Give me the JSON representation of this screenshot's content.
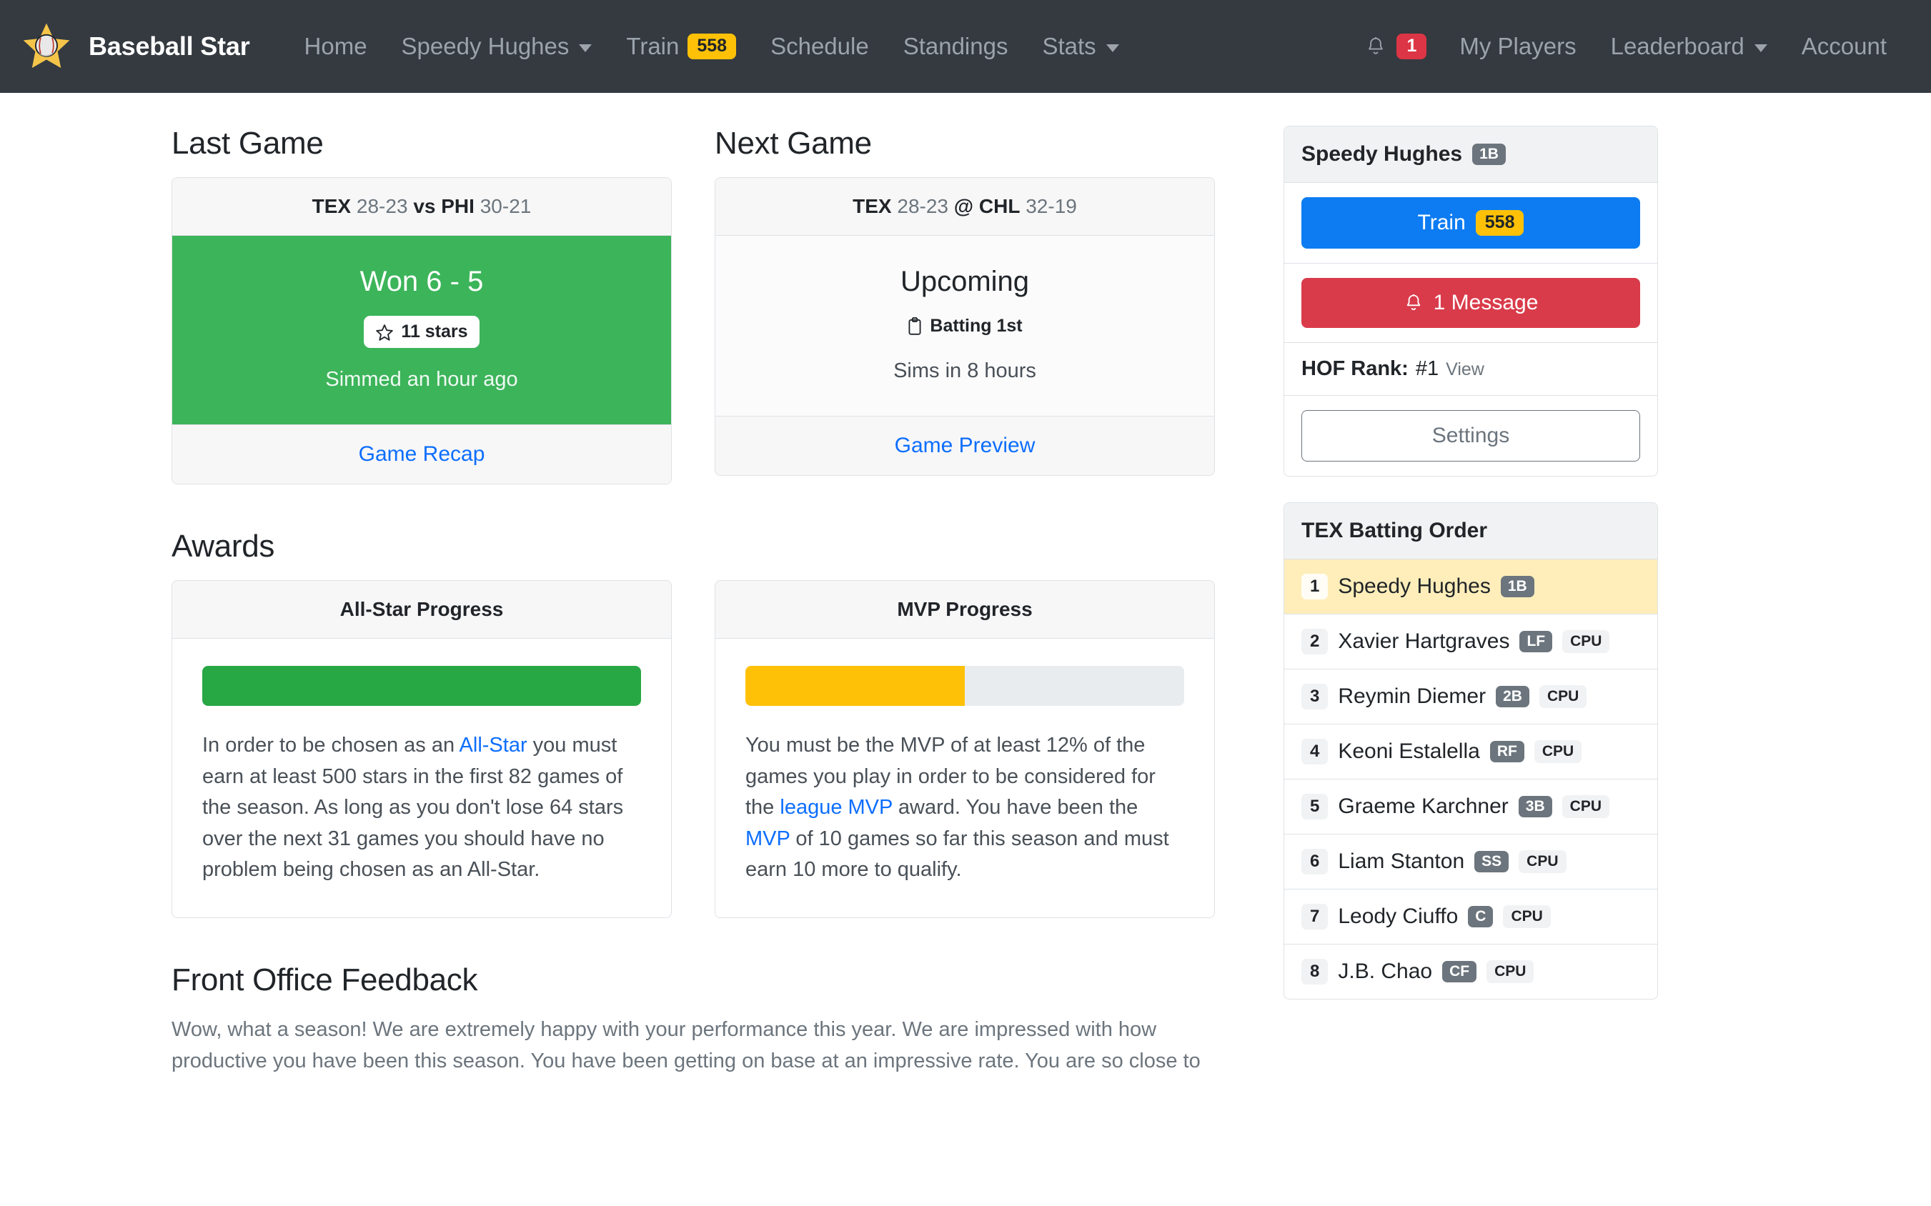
{
  "navbar": {
    "logo_icon": "baseball-star-logo",
    "brand": "Baseball Star",
    "links": [
      {
        "label": "Home",
        "caret": false,
        "badge": null
      },
      {
        "label": "Speedy Hughes",
        "caret": true,
        "badge": null
      },
      {
        "label": "Train",
        "caret": false,
        "badge": "558"
      },
      {
        "label": "Schedule",
        "caret": false,
        "badge": null
      },
      {
        "label": "Standings",
        "caret": false,
        "badge": null
      },
      {
        "label": "Stats",
        "caret": true,
        "badge": null
      }
    ],
    "notification_icon": "bell-icon",
    "notification_count": "1",
    "right_links": [
      {
        "label": "My Players",
        "caret": false
      },
      {
        "label": "Leaderboard",
        "caret": true
      },
      {
        "label": "Account",
        "caret": false
      }
    ]
  },
  "last_game": {
    "heading": "Last Game",
    "home_team": "TEX",
    "home_record": "28-23",
    "separator": "vs",
    "away_team": "PHI",
    "away_record": "30-21",
    "result": "Won 6 - 5",
    "stars_icon": "star-outline-icon",
    "stars": "11 stars",
    "simmed": "Simmed an hour ago",
    "link": "Game Recap"
  },
  "next_game": {
    "heading": "Next Game",
    "home_team": "TEX",
    "home_record": "28-23",
    "separator": "@",
    "away_team": "CHL",
    "away_record": "32-19",
    "status": "Upcoming",
    "batting_icon": "clipboard-icon",
    "batting": "Batting 1st",
    "sims_in": "Sims in 8 hours",
    "link": "Game Preview"
  },
  "awards": {
    "heading": "Awards",
    "all_star": {
      "title": "All-Star Progress",
      "progress_percent": 100,
      "progress_color": "#28a745",
      "text_parts": [
        {
          "t": "In order to be chosen as an ",
          "link": false
        },
        {
          "t": "All-Star",
          "link": true
        },
        {
          "t": " you must earn at least 500 stars in the first 82 games of the season. As long as you don't lose 64 stars over the next 31 games you should have no problem being chosen as an All-Star.",
          "link": false
        }
      ]
    },
    "mvp": {
      "title": "MVP Progress",
      "progress_percent": 50,
      "progress_color": "#ffc107",
      "text_parts": [
        {
          "t": "You must be the MVP of at least 12% of the games you play in order to be considered for the ",
          "link": false
        },
        {
          "t": "league MVP",
          "link": true
        },
        {
          "t": " award. You have been the ",
          "link": false
        },
        {
          "t": "MVP",
          "link": true
        },
        {
          "t": " of 10 games so far this season and must earn 10 more to qualify.",
          "link": false
        }
      ]
    }
  },
  "feedback": {
    "heading": "Front Office Feedback",
    "body": "Wow, what a season! We are extremely happy with your performance this year. We are impressed with how productive you have been this season. You have been getting on base at an impressive rate. You are so close to"
  },
  "player_panel": {
    "name": "Speedy Hughes",
    "position": "1B",
    "train_label": "Train",
    "train_count": "558",
    "message_icon": "bell-icon",
    "message_label": "1 Message",
    "hof_label": "HOF Rank:",
    "hof_value": "#1",
    "hof_view": "View",
    "settings_label": "Settings"
  },
  "batting_order": {
    "title": "TEX Batting Order",
    "rows": [
      {
        "order": "1",
        "name": "Speedy Hughes",
        "pos": "1B",
        "cpu": null,
        "active": true
      },
      {
        "order": "2",
        "name": "Xavier Hartgraves",
        "pos": "LF",
        "cpu": "CPU",
        "active": false
      },
      {
        "order": "3",
        "name": "Reymin Diemer",
        "pos": "2B",
        "cpu": "CPU",
        "active": false
      },
      {
        "order": "4",
        "name": "Keoni Estalella",
        "pos": "RF",
        "cpu": "CPU",
        "active": false
      },
      {
        "order": "5",
        "name": "Graeme Karchner",
        "pos": "3B",
        "cpu": "CPU",
        "active": false
      },
      {
        "order": "6",
        "name": "Liam Stanton",
        "pos": "SS",
        "cpu": "CPU",
        "active": false
      },
      {
        "order": "7",
        "name": "Leody Ciuffo",
        "pos": "C",
        "cpu": "CPU",
        "active": false
      },
      {
        "order": "8",
        "name": "J.B. Chao",
        "pos": "CF",
        "cpu": "CPU",
        "active": false
      }
    ]
  },
  "colors": {
    "navbar_bg": "#343a40",
    "win_green": "#3cb45a",
    "accent_blue": "#0d6efd",
    "amber": "#ffc107",
    "danger": "#d93b4a",
    "highlight_row": "#ffeeba"
  }
}
